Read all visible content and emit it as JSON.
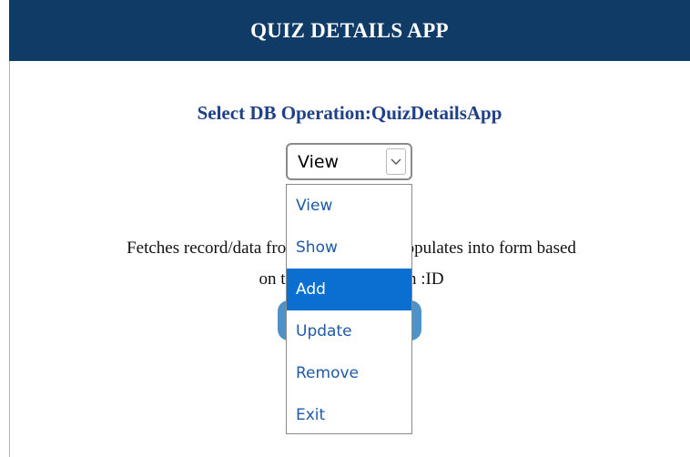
{
  "header": {
    "title": "QUIZ DETAILS APP"
  },
  "operation": {
    "label": "Select DB Operation:QuizDetailsApp",
    "selected_value": "View",
    "options": [
      "View",
      "Show",
      "Add",
      "Update",
      "Remove",
      "Exit"
    ],
    "highlighted_option": "Add"
  },
  "description": {
    "line1": "Fetches record/data from database and populates into form based",
    "line2": "on the value entered in :ID"
  },
  "icons": {
    "dropdown_arrow": "chevron-down-icon"
  },
  "colors": {
    "header_bg": "#0f3b66",
    "label_text": "#1f3f86",
    "option_text": "#1f5aa6",
    "option_highlight": "#0a6fd1",
    "button_bg": "#4f93c6"
  }
}
